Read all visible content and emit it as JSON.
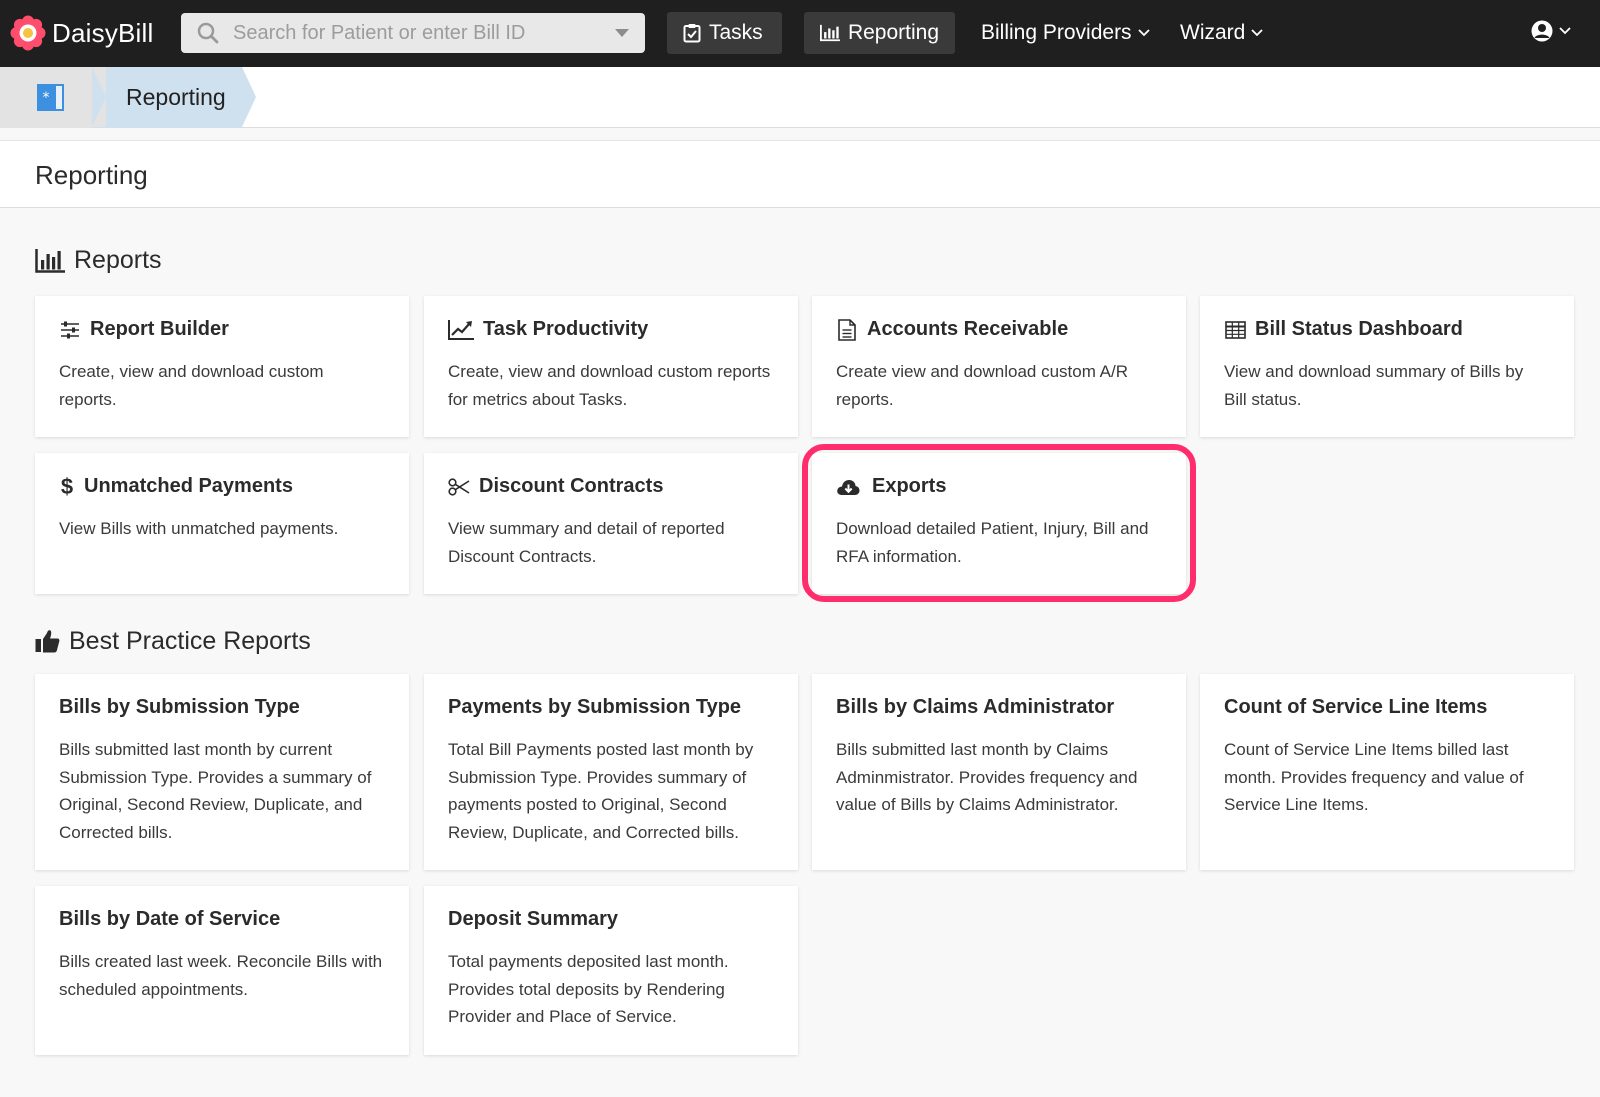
{
  "nav": {
    "brand": "DaisyBill",
    "search_placeholder": "Search for Patient or enter Bill ID",
    "tasks": "Tasks",
    "reporting": "Reporting",
    "billing_providers": "Billing Providers",
    "wizard": "Wizard",
    "icons": [
      "daisy-logo-icon",
      "search-icon",
      "clipboard-check-icon",
      "bar-chart-icon",
      "chevron-down-icon",
      "user-circle-icon"
    ]
  },
  "breadcrumb": {
    "current": "Reporting"
  },
  "page": {
    "title": "Reporting"
  },
  "reports": {
    "heading": "Reports",
    "cards": [
      {
        "title": "Report Builder",
        "desc": "Create, view and download custom reports.",
        "icon": "sliders-icon"
      },
      {
        "title": "Task Productivity",
        "desc": "Create, view and download custom reports for metrics about Tasks.",
        "icon": "line-chart-icon"
      },
      {
        "title": "Accounts Receivable",
        "desc": "Create view and download custom A/R reports.",
        "icon": "document-icon"
      },
      {
        "title": "Bill Status Dashboard",
        "desc": "View and download summary of Bills by Bill status.",
        "icon": "table-icon"
      },
      {
        "title": "Unmatched Payments",
        "desc": "View Bills with unmatched payments.",
        "icon": "dollar-icon"
      },
      {
        "title": "Discount Contracts",
        "desc": "View summary and detail of reported Discount Contracts.",
        "icon": "scissors-icon"
      },
      {
        "title": "Exports",
        "desc": "Download detailed Patient, Injury, Bill and RFA information.",
        "icon": "cloud-download-icon"
      }
    ]
  },
  "best_practice": {
    "heading": "Best Practice Reports",
    "cards": [
      {
        "title": "Bills by Submission Type",
        "desc": "Bills submitted last month by current Submission Type. Provides a summary of Original, Second Review, Duplicate, and Corrected bills."
      },
      {
        "title": "Payments by Submission Type",
        "desc": "Total Bill Payments posted last month by Submission Type. Provides summary of payments posted to Original, Second Review, Duplicate, and Corrected bills."
      },
      {
        "title": "Bills by Claims Administrator",
        "desc": "Bills submitted last month by Claims Adminmistrator. Provides frequency and value of Bills by Claims Administrator."
      },
      {
        "title": "Count of Service Line Items",
        "desc": "Count of Service Line Items billed last month. Provides frequency and value of Service Line Items."
      },
      {
        "title": "Bills by Date of Service",
        "desc": "Bills created last week. Reconcile Bills with scheduled appointments."
      },
      {
        "title": "Deposit Summary",
        "desc": "Total payments deposited last month. Provides total deposits by Rendering Provider and Place of Service."
      }
    ]
  },
  "colors": {
    "nav_bg": "#1f1f1f",
    "highlight": "#ff2d6e",
    "breadcrumb_active": "#cfe0ef"
  }
}
